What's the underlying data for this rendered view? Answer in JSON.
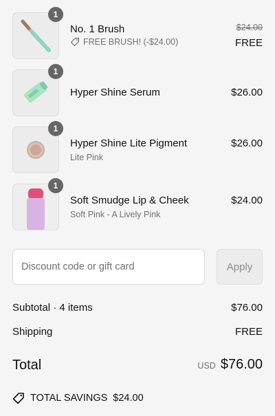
{
  "items": [
    {
      "name": "No. 1 Brush",
      "quantity": "1",
      "price": "FREE",
      "original_price": "$24.00",
      "discount": "FREE BRUSH! (-$24.00)",
      "discount_icon": "tag-icon"
    },
    {
      "name": "Hyper Shine Serum",
      "quantity": "1",
      "price": "$26.00"
    },
    {
      "name": "Hyper Shine Lite Pigment",
      "quantity": "1",
      "price": "$26.00",
      "variant": "Lite Pink"
    },
    {
      "name": "Soft Smudge Lip & Cheek",
      "quantity": "1",
      "price": "$24.00",
      "variant": "Soft Pink - A Lively Pink"
    }
  ],
  "discount": {
    "placeholder": "Discount code or gift card",
    "value": "",
    "apply_label": "Apply"
  },
  "summary": {
    "subtotal_label": "Subtotal · 4 items",
    "subtotal_value": "$76.00",
    "shipping_label": "Shipping",
    "shipping_value": "FREE",
    "total_label": "Total",
    "currency": "USD",
    "total_value": "$76.00",
    "savings_label": "TOTAL SAVINGS",
    "savings_value": "$24.00",
    "savings_icon": "tag-icon"
  },
  "colors": {
    "background": "#f5f5f5",
    "badge": "#666666",
    "muted_text": "#707070"
  }
}
